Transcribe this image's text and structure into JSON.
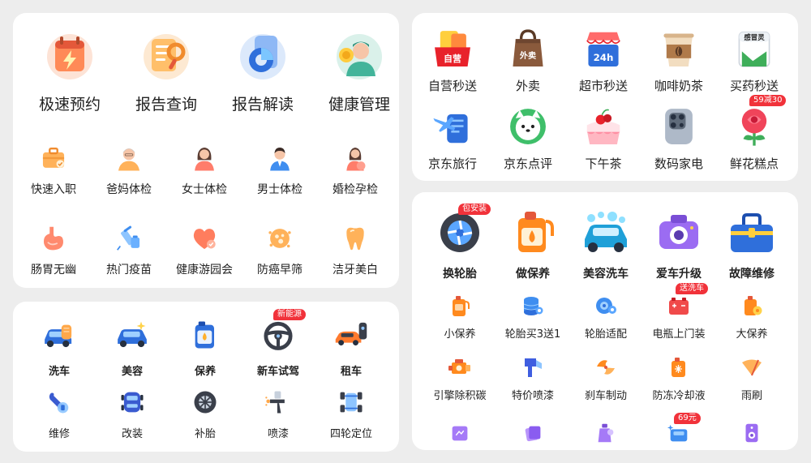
{
  "health": {
    "big": [
      {
        "label": "极速预约",
        "icon": "calendar-lightning-icon"
      },
      {
        "label": "报告查询",
        "icon": "report-search-icon"
      },
      {
        "label": "报告解读",
        "icon": "report-chart-icon"
      },
      {
        "label": "健康管理",
        "icon": "doctor-coin-icon"
      }
    ],
    "small": [
      {
        "label": "快速入职",
        "icon": "briefcase-icon"
      },
      {
        "label": "爸妈体检",
        "icon": "elder-icon"
      },
      {
        "label": "女士体检",
        "icon": "woman-icon"
      },
      {
        "label": "男士体检",
        "icon": "man-icon"
      },
      {
        "label": "婚检孕检",
        "icon": "pregnant-icon"
      },
      {
        "label": "肠胃无幽",
        "icon": "stomach-icon"
      },
      {
        "label": "热门疫苗",
        "icon": "vaccine-icon"
      },
      {
        "label": "健康游园会",
        "icon": "heart-icon"
      },
      {
        "label": "防癌早筛",
        "icon": "cell-icon"
      },
      {
        "label": "洁牙美白",
        "icon": "tooth-icon"
      }
    ]
  },
  "car": {
    "items": [
      {
        "label": "洗车",
        "icon": "car-wash-icon"
      },
      {
        "label": "美容",
        "icon": "car-sparkle-icon"
      },
      {
        "label": "保养",
        "icon": "oil-can-icon"
      },
      {
        "label": "新车试驾",
        "icon": "steering-wheel-icon",
        "badge": "新能源"
      },
      {
        "label": "租车",
        "icon": "car-key-icon"
      },
      {
        "label": "维修",
        "icon": "wrench-icon"
      },
      {
        "label": "改装",
        "icon": "car-top-icon"
      },
      {
        "label": "补胎",
        "icon": "tire-icon"
      },
      {
        "label": "喷漆",
        "icon": "spray-gun-icon"
      },
      {
        "label": "四轮定位",
        "icon": "wheel-alignment-icon"
      }
    ]
  },
  "delivery": {
    "items": [
      {
        "label": "自营秒送",
        "icon": "self-run-icon",
        "text": "自营"
      },
      {
        "label": "外卖",
        "icon": "takeout-bag-icon",
        "text": "外卖"
      },
      {
        "label": "超市秒送",
        "icon": "supermarket-24h-icon",
        "text": "24h"
      },
      {
        "label": "咖啡奶茶",
        "icon": "coffee-cup-icon"
      },
      {
        "label": "买药秒送",
        "icon": "medicine-box-icon",
        "text": "感冒灵"
      },
      {
        "label": "京东旅行",
        "icon": "travel-plane-icon"
      },
      {
        "label": "京东点评",
        "icon": "review-dog-icon"
      },
      {
        "label": "下午茶",
        "icon": "cake-icon"
      },
      {
        "label": "数码家电",
        "icon": "phone-camera-icon"
      },
      {
        "label": "鲜花糕点",
        "icon": "rose-icon",
        "badge": "59减30"
      }
    ]
  },
  "carservice": {
    "big": [
      {
        "label": "换轮胎",
        "icon": "tire-change-icon",
        "badge": "包安装"
      },
      {
        "label": "做保养",
        "icon": "engine-oil-icon"
      },
      {
        "label": "美容洗车",
        "icon": "car-wash-blue-icon"
      },
      {
        "label": "爱车升级",
        "icon": "dashcam-icon"
      },
      {
        "label": "故障维修",
        "icon": "toolbox-icon"
      }
    ],
    "small": [
      {
        "label": "小保养",
        "icon": "oil-bottle-icon"
      },
      {
        "label": "轮胎买3送1",
        "icon": "tire-stack-icon"
      },
      {
        "label": "轮胎适配",
        "icon": "tire-fit-icon"
      },
      {
        "label": "电瓶上门装",
        "icon": "battery-icon",
        "badge": "送洗车"
      },
      {
        "label": "大保养",
        "icon": "oil-gear-icon"
      },
      {
        "label": "引擎除积碳",
        "icon": "engine-icon"
      },
      {
        "label": "特价喷漆",
        "icon": "paint-icon"
      },
      {
        "label": "刹车制动",
        "icon": "brake-icon"
      },
      {
        "label": "防冻冷却液",
        "icon": "coolant-icon"
      },
      {
        "label": "雨刷",
        "icon": "wiper-icon"
      }
    ],
    "partial": [
      {
        "icon": "purple-box-icon"
      },
      {
        "icon": "purple-cards-icon"
      },
      {
        "icon": "purple-bottle-icon"
      },
      {
        "icon": "blue-car-sparkle-icon",
        "badge": "69元"
      },
      {
        "icon": "speaker-icon"
      }
    ]
  }
}
